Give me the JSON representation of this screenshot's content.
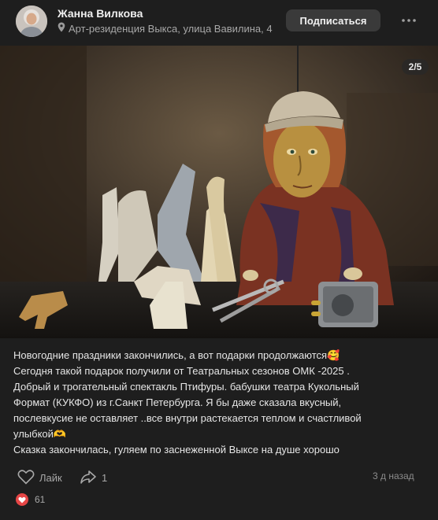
{
  "post": {
    "author": "Жанна Вилкова",
    "location": "Арт-резиденция Выкса, улица Вавилина, 4",
    "subscribe_label": "Подписаться",
    "photo_counter": "2/5",
    "text_lines": [
      "Новогодние праздники закончились, а вот подарки продолжаются🥰",
      "Сегодня такой подарок получили от Театральных сезонов ОМК -2025 .",
      "Добрый и трогательный спектакль Птифуры. бабушки театра Кукольный",
      "Формат (КУКФО) из г.Санкт Петербурга. Я бы даже сказала вкусный,",
      "послевкусие не оставляет ..все внутри растекается теплом и счастливой",
      "улыбкой🫶",
      "Сказка закончилась, гуляем по заснеженной Выксе на душе хорошо"
    ],
    "like_label": "Лайк",
    "share_count": "1",
    "date": "3 д назад",
    "reactions_count": "61"
  },
  "icons": {
    "location": "map-pin-icon",
    "more": "more-dots-icon",
    "like": "heart-outline-icon",
    "share": "share-arrow-icon",
    "reaction": "heart-filled-icon"
  },
  "colors": {
    "background": "#1e1e1e",
    "subscribe_bg": "#3a3a3a",
    "reaction_red": "#e64646"
  }
}
